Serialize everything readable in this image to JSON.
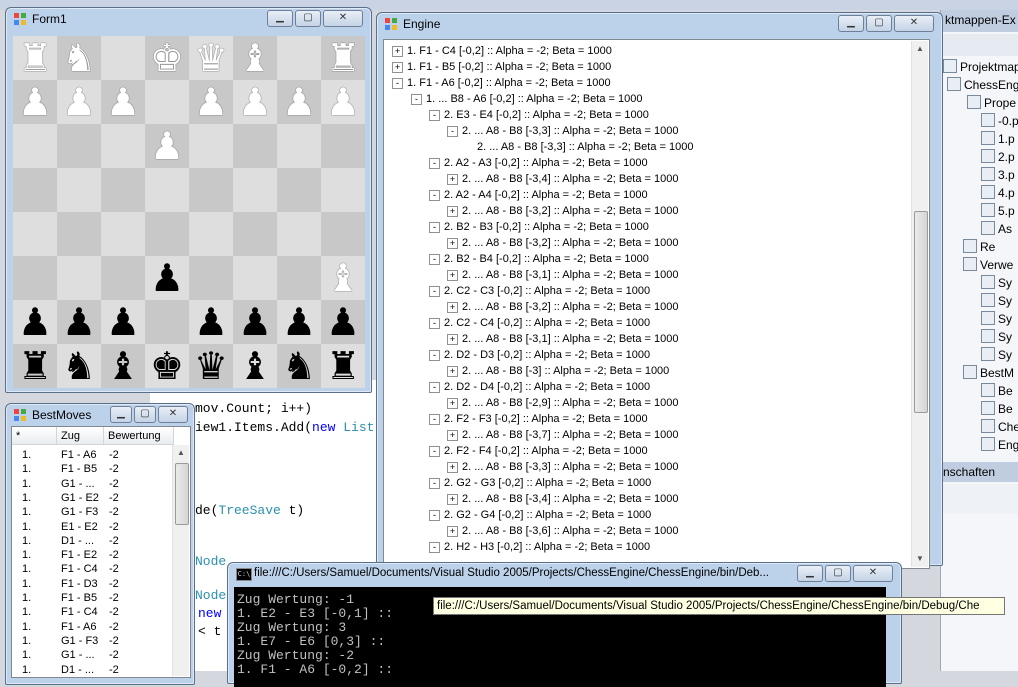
{
  "form1": {
    "title": "Form1"
  },
  "board": [
    [
      "wr",
      "wn",
      "",
      "wk",
      "wq",
      "wb",
      "",
      "wr"
    ],
    [
      "wp",
      "wp",
      "wp",
      "",
      "wp",
      "wp",
      "wp",
      "wp"
    ],
    [
      "",
      "",
      "",
      "wp",
      "",
      "",
      "",
      ""
    ],
    [
      "",
      "",
      "",
      "",
      "",
      "",
      "",
      ""
    ],
    [
      "",
      "",
      "",
      "",
      "",
      "",
      "",
      ""
    ],
    [
      "",
      "",
      "",
      "bp",
      "",
      "",
      "",
      "wb"
    ],
    [
      "bp",
      "bp",
      "bp",
      "",
      "bp",
      "bp",
      "bp",
      "bp"
    ],
    [
      "br",
      "bn",
      "bb",
      "bk",
      "bq",
      "bb",
      "bn",
      "br"
    ]
  ],
  "engine": {
    "title": "Engine",
    "rows": [
      {
        "level": 0,
        "toggle": "+",
        "text": "1. F1 - C4 [-0,2] :: Alpha = -2; Beta = 1000"
      },
      {
        "level": 0,
        "toggle": "+",
        "text": "1. F1 - B5 [-0,2] :: Alpha = -2; Beta = 1000"
      },
      {
        "level": 0,
        "toggle": "-",
        "text": "1. F1 - A6 [-0,2] :: Alpha = -2; Beta = 1000"
      },
      {
        "level": 1,
        "toggle": "-",
        "text": "1. ... B8 - A6 [-0,2] :: Alpha = -2; Beta = 1000"
      },
      {
        "level": 2,
        "toggle": "-",
        "text": "2. E3 - E4 [-0,2] :: Alpha = -2; Beta = 1000"
      },
      {
        "level": 3,
        "toggle": "-",
        "text": "2. ... A8 - B8 [-3,3] :: Alpha = -2; Beta = 1000"
      },
      {
        "level": 4,
        "toggle": "",
        "text": "2. ... A8 - B8 [-3,3] :: Alpha = -2; Beta = 1000"
      },
      {
        "level": 2,
        "toggle": "-",
        "text": "2. A2 - A3 [-0,2] :: Alpha = -2; Beta = 1000"
      },
      {
        "level": 3,
        "toggle": "+",
        "text": "2. ... A8 - B8 [-3,4] :: Alpha = -2; Beta = 1000"
      },
      {
        "level": 2,
        "toggle": "-",
        "text": "2. A2 - A4 [-0,2] :: Alpha = -2; Beta = 1000"
      },
      {
        "level": 3,
        "toggle": "+",
        "text": "2. ... A8 - B8 [-3,2] :: Alpha = -2; Beta = 1000"
      },
      {
        "level": 2,
        "toggle": "-",
        "text": "2. B2 - B3 [-0,2] :: Alpha = -2; Beta = 1000"
      },
      {
        "level": 3,
        "toggle": "+",
        "text": "2. ... A8 - B8 [-3,2] :: Alpha = -2; Beta = 1000"
      },
      {
        "level": 2,
        "toggle": "-",
        "text": "2. B2 - B4 [-0,2] :: Alpha = -2; Beta = 1000"
      },
      {
        "level": 3,
        "toggle": "+",
        "text": "2. ... A8 - B8 [-3,1] :: Alpha = -2; Beta = 1000"
      },
      {
        "level": 2,
        "toggle": "-",
        "text": "2. C2 - C3 [-0,2] :: Alpha = -2; Beta = 1000"
      },
      {
        "level": 3,
        "toggle": "+",
        "text": "2. ... A8 - B8 [-3,2] :: Alpha = -2; Beta = 1000"
      },
      {
        "level": 2,
        "toggle": "-",
        "text": "2. C2 - C4 [-0,2] :: Alpha = -2; Beta = 1000"
      },
      {
        "level": 3,
        "toggle": "+",
        "text": "2. ... A8 - B8 [-3,1] :: Alpha = -2; Beta = 1000"
      },
      {
        "level": 2,
        "toggle": "-",
        "text": "2. D2 - D3 [-0,2] :: Alpha = -2; Beta = 1000"
      },
      {
        "level": 3,
        "toggle": "+",
        "text": "2. ... A8 - B8 [-3] :: Alpha = -2; Beta = 1000"
      },
      {
        "level": 2,
        "toggle": "-",
        "text": "2. D2 - D4 [-0,2] :: Alpha = -2; Beta = 1000"
      },
      {
        "level": 3,
        "toggle": "+",
        "text": "2. ... A8 - B8 [-2,9] :: Alpha = -2; Beta = 1000"
      },
      {
        "level": 2,
        "toggle": "-",
        "text": "2. F2 - F3 [-0,2] :: Alpha = -2; Beta = 1000"
      },
      {
        "level": 3,
        "toggle": "+",
        "text": "2. ... A8 - B8 [-3,7] :: Alpha = -2; Beta = 1000"
      },
      {
        "level": 2,
        "toggle": "-",
        "text": "2. F2 - F4 [-0,2] :: Alpha = -2; Beta = 1000"
      },
      {
        "level": 3,
        "toggle": "+",
        "text": "2. ... A8 - B8 [-3,3] :: Alpha = -2; Beta = 1000"
      },
      {
        "level": 2,
        "toggle": "-",
        "text": "2. G2 - G3 [-0,2] :: Alpha = -2; Beta = 1000"
      },
      {
        "level": 3,
        "toggle": "+",
        "text": "2. ... A8 - B8 [-3,4] :: Alpha = -2; Beta = 1000"
      },
      {
        "level": 2,
        "toggle": "-",
        "text": "2. G2 - G4 [-0,2] :: Alpha = -2; Beta = 1000"
      },
      {
        "level": 3,
        "toggle": "+",
        "text": "2. ... A8 - B8 [-3,6] :: Alpha = -2; Beta = 1000"
      },
      {
        "level": 2,
        "toggle": "-",
        "text": "2. H2 - H3 [-0,2] :: Alpha = -2; Beta = 1000"
      }
    ]
  },
  "bestmoves": {
    "title": "BestMoves",
    "columns": [
      "*",
      "Zug",
      "Bewertung"
    ],
    "rows": [
      [
        "1.",
        "F1 - A6",
        "-2"
      ],
      [
        "1.",
        "F1 - B5",
        "-2"
      ],
      [
        "1.",
        "G1 - ...",
        "-2"
      ],
      [
        "1.",
        "G1 - E2",
        "-2"
      ],
      [
        "1.",
        "G1 - F3",
        "-2"
      ],
      [
        "1.",
        "E1 - E2",
        "-2"
      ],
      [
        "1.",
        "D1 - ...",
        "-2"
      ],
      [
        "1.",
        "F1 - E2",
        "-2"
      ],
      [
        "1.",
        "F1 - C4",
        "-2"
      ],
      [
        "1.",
        "F1 - D3",
        "-2"
      ],
      [
        "1.",
        "F1 - B5",
        "-2"
      ],
      [
        "1.",
        "F1 - C4",
        "-2"
      ],
      [
        "1.",
        "F1 - A6",
        "-2"
      ],
      [
        "1.",
        "G1 - F3",
        "-2"
      ],
      [
        "1.",
        "G1 - ...",
        "-2"
      ],
      [
        "1.",
        "D1 - ...",
        "-2"
      ]
    ]
  },
  "console": {
    "title": "file:///C:/Users/Samuel/Documents/Visual Studio 2005/Projects/ChessEngine/ChessEngine/bin/Deb...",
    "lines": [
      "Zug Wertung: -1",
      "1. E2 - E3 [-0,1] ::",
      "Zug Wertung: 3",
      "1. E7 - E6 [0,3] ::",
      "Zug Wertung: -2",
      "1. F1 - A6 [-0,2] ::"
    ],
    "tooltip": "file:///C:/Users/Samuel/Documents/Visual Studio 2005/Projects/ChessEngine/ChessEngine/bin/Debug/Che"
  },
  "ide": {
    "code": [
      {
        "pre": "mov.Count; i++)",
        "kw": "",
        "post": ""
      },
      {
        "pre": "iew1.Items.Add(",
        "kw": "new",
        "post": " List"
      },
      {
        "pre": "de(",
        "ty": "TreeSave",
        "post": " t)"
      },
      {
        "pre": "Node",
        "kw": "",
        "post": ""
      },
      {
        "pre": "Node",
        "kw": "",
        "post": ""
      },
      {
        "pre": "",
        "kw": "new",
        "post": ""
      },
      {
        "pre": "< t",
        "kw": "",
        "post": ""
      }
    ],
    "panel_title": "ktmappen-Ex",
    "panel_items": [
      "Projektmappe",
      "ChessEng",
      "Prope",
      "-0.p",
      "1.p",
      "2.p",
      "3.p",
      "4.p",
      "5.p",
      "As",
      "Re",
      "Verwe",
      "Sy",
      "Sy",
      "Sy",
      "Sy",
      "Sy",
      "BestM",
      "Be",
      "Be",
      "Chess",
      "Engine"
    ],
    "props_title": "nschaften"
  }
}
